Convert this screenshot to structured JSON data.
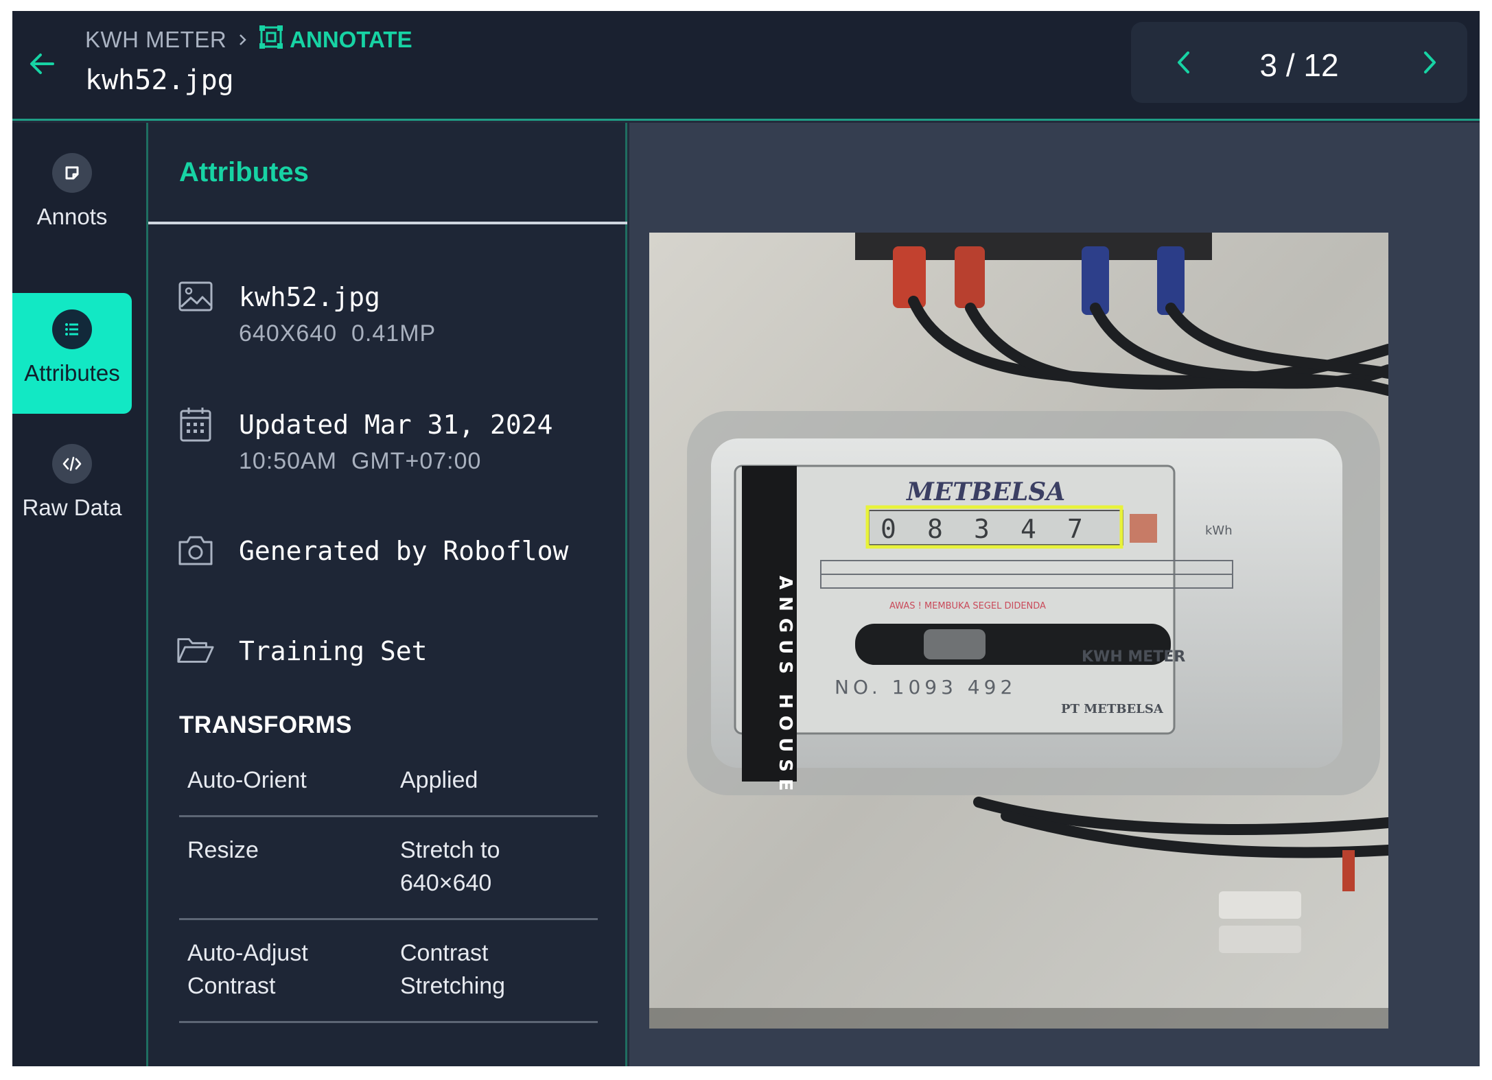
{
  "header": {
    "project": "KWH METER",
    "section": "ANNOTATE",
    "filename": "kwh52.jpg",
    "pager": "3 / 12"
  },
  "rail": {
    "items": [
      {
        "label": "Annots",
        "icon": "annotation-icon"
      },
      {
        "label": "Attributes",
        "icon": "list-icon",
        "active": true
      },
      {
        "label": "Raw Data",
        "icon": "code-icon"
      }
    ]
  },
  "panel": {
    "title": "Attributes",
    "file": {
      "name": "kwh52.jpg",
      "dims": "640X640  0.41MP"
    },
    "updated": {
      "main": "Updated Mar 31, 2024",
      "sub": "10:50AM  GMT+07:00"
    },
    "generated": "Generated by Roboflow",
    "split": "Training Set",
    "transforms_label": "TRANSFORMS",
    "transforms": [
      {
        "name": "Auto-Orient",
        "value": "Applied"
      },
      {
        "name": "Resize",
        "value": "Stretch to\n640×640"
      },
      {
        "name": "Auto-Adjust\nContrast",
        "value": "Contrast\nStretching"
      }
    ]
  },
  "image": {
    "brand": "METBELSA",
    "digits": [
      "0",
      "8",
      "3",
      "4",
      "7"
    ],
    "unit": "kWh",
    "tag": "ANGUS HOUSE",
    "model_label": "KWH METER",
    "serial": "NO. 1093 492",
    "maker": "PT METBELSA",
    "bbox_color": "#e8f23a",
    "accent": "#17d3a4"
  }
}
